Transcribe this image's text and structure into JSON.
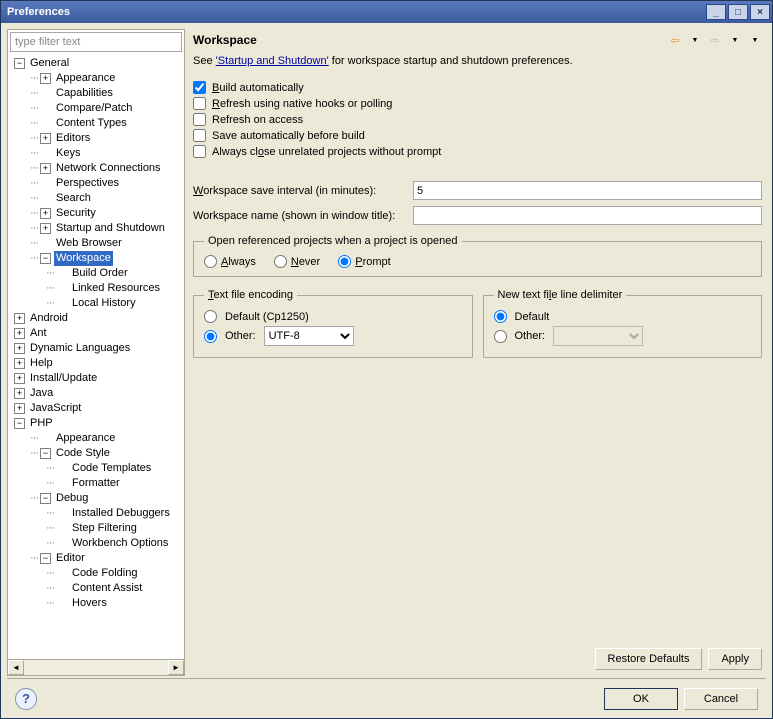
{
  "title": "Preferences",
  "filter_placeholder": "type filter text",
  "tree": [
    {
      "label": "General",
      "depth": 0,
      "expander": "-",
      "selected": false,
      "children": [
        {
          "label": "Appearance",
          "depth": 1,
          "expander": "+"
        },
        {
          "label": "Capabilities",
          "depth": 1,
          "expander": ""
        },
        {
          "label": "Compare/Patch",
          "depth": 1,
          "expander": ""
        },
        {
          "label": "Content Types",
          "depth": 1,
          "expander": ""
        },
        {
          "label": "Editors",
          "depth": 1,
          "expander": "+"
        },
        {
          "label": "Keys",
          "depth": 1,
          "expander": ""
        },
        {
          "label": "Network Connections",
          "depth": 1,
          "expander": "+"
        },
        {
          "label": "Perspectives",
          "depth": 1,
          "expander": ""
        },
        {
          "label": "Search",
          "depth": 1,
          "expander": ""
        },
        {
          "label": "Security",
          "depth": 1,
          "expander": "+"
        },
        {
          "label": "Startup and Shutdown",
          "depth": 1,
          "expander": "+"
        },
        {
          "label": "Web Browser",
          "depth": 1,
          "expander": ""
        },
        {
          "label": "Workspace",
          "depth": 1,
          "expander": "-",
          "selected": true,
          "children": [
            {
              "label": "Build Order",
              "depth": 2,
              "expander": ""
            },
            {
              "label": "Linked Resources",
              "depth": 2,
              "expander": ""
            },
            {
              "label": "Local History",
              "depth": 2,
              "expander": ""
            }
          ]
        }
      ]
    },
    {
      "label": "Android",
      "depth": 0,
      "expander": "+"
    },
    {
      "label": "Ant",
      "depth": 0,
      "expander": "+"
    },
    {
      "label": "Dynamic Languages",
      "depth": 0,
      "expander": "+"
    },
    {
      "label": "Help",
      "depth": 0,
      "expander": "+"
    },
    {
      "label": "Install/Update",
      "depth": 0,
      "expander": "+"
    },
    {
      "label": "Java",
      "depth": 0,
      "expander": "+"
    },
    {
      "label": "JavaScript",
      "depth": 0,
      "expander": "+"
    },
    {
      "label": "PHP",
      "depth": 0,
      "expander": "-",
      "children": [
        {
          "label": "Appearance",
          "depth": 1,
          "expander": ""
        },
        {
          "label": "Code Style",
          "depth": 1,
          "expander": "-",
          "children": [
            {
              "label": "Code Templates",
              "depth": 2,
              "expander": ""
            },
            {
              "label": "Formatter",
              "depth": 2,
              "expander": ""
            }
          ]
        },
        {
          "label": "Debug",
          "depth": 1,
          "expander": "-",
          "children": [
            {
              "label": "Installed Debuggers",
              "depth": 2,
              "expander": ""
            },
            {
              "label": "Step Filtering",
              "depth": 2,
              "expander": ""
            },
            {
              "label": "Workbench Options",
              "depth": 2,
              "expander": ""
            }
          ]
        },
        {
          "label": "Editor",
          "depth": 1,
          "expander": "-",
          "children": [
            {
              "label": "Code Folding",
              "depth": 2,
              "expander": ""
            },
            {
              "label": "Content Assist",
              "depth": 2,
              "expander": ""
            },
            {
              "label": "Hovers",
              "depth": 2,
              "expander": ""
            }
          ]
        }
      ]
    }
  ],
  "page": {
    "heading": "Workspace",
    "intro_pre": "See ",
    "intro_link": "'Startup and Shutdown'",
    "intro_post": " for workspace startup and shutdown preferences.",
    "checks": {
      "build_auto": {
        "label_pre": "",
        "u": "B",
        "label_post": "uild automatically",
        "checked": true
      },
      "refresh_native": {
        "label_pre": "",
        "u": "R",
        "label_post": "efresh using native hooks or polling",
        "checked": false
      },
      "refresh_access": {
        "label": "Refresh on access",
        "checked": false
      },
      "save_before": {
        "label": "Save automatically before build",
        "checked": false
      },
      "close_unrelated": {
        "label_pre": "Always cl",
        "u": "o",
        "label_post": "se unrelated projects without prompt",
        "checked": false
      }
    },
    "save_interval": {
      "label_pre": "",
      "u": "W",
      "label_post": "orkspace save interval (in minutes):",
      "value": "5"
    },
    "workspace_name": {
      "label": "Workspace name (shown in window title):",
      "value": ""
    },
    "open_ref": {
      "legend": "Open referenced projects when a project is opened",
      "always": {
        "u": "A",
        "post": "lways"
      },
      "never": {
        "u": "N",
        "post": "ever"
      },
      "prompt": {
        "u": "P",
        "post": "rompt"
      },
      "selected": "prompt"
    },
    "encoding": {
      "legend_u": "T",
      "legend_post": "ext file encoding",
      "default_label": "Default (Cp1250)",
      "other_label": "Other:",
      "other_value": "UTF-8",
      "selected": "other",
      "options": [
        "UTF-8"
      ]
    },
    "delimiter": {
      "legend_pre": "New text fi",
      "legend_u": "l",
      "legend_post": "e line delimiter",
      "default_label": "Default",
      "other_label": "Other:",
      "selected": "default"
    },
    "buttons": {
      "restore": "Restore Defaults",
      "apply": "Apply",
      "ok": "OK",
      "cancel": "Cancel"
    }
  }
}
